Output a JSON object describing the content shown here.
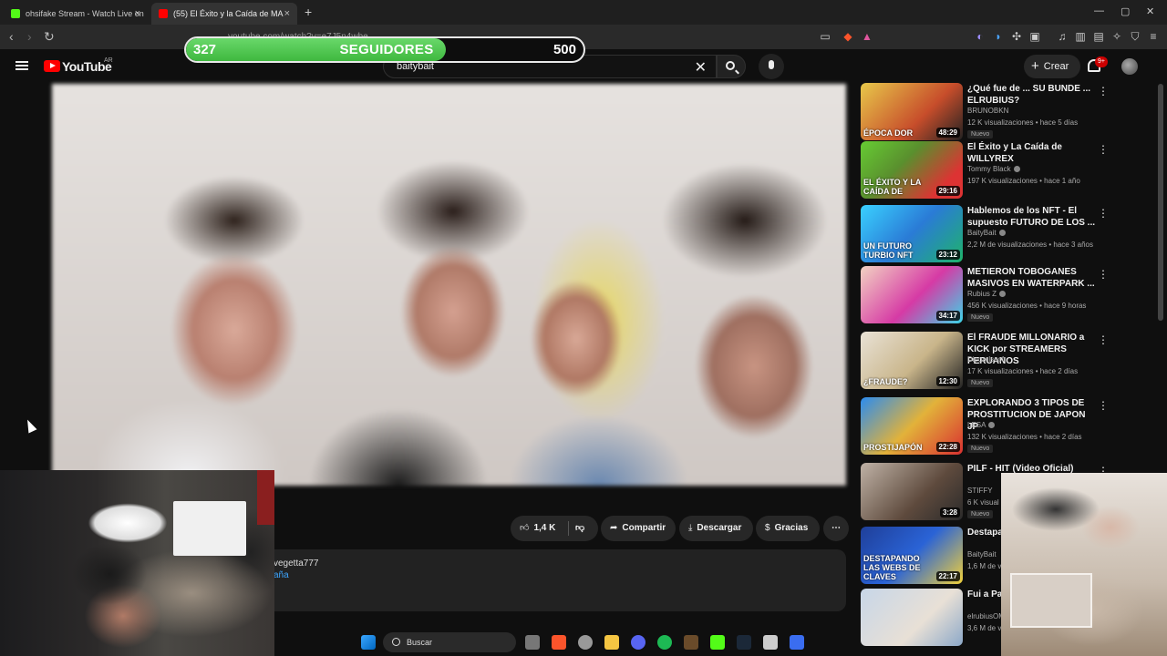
{
  "browser": {
    "tabs": [
      {
        "title": "ohsifake Stream - Watch Live on",
        "favicon_color": "#53fc18"
      },
      {
        "title": "(55) El Éxito y la Caída de MA",
        "favicon_color": "#ff0000"
      }
    ],
    "new_tab": "+",
    "address_partial": "youtube.com/watch?v=e7J5n4wbe"
  },
  "overlay": {
    "current": "327",
    "label": "SEGUIDORES",
    "goal": "500",
    "progress_fraction": 0.654,
    "bar_color": "#4cc24c"
  },
  "youtube": {
    "logo_text": "YouTube",
    "country": "AR",
    "search": {
      "value": "baitybait"
    },
    "create_label": "Crear",
    "notifications": "9+"
  },
  "actions": {
    "likes": "1,4 K",
    "share": "Compartir",
    "download": "Descargar",
    "thanks": "Gracias"
  },
  "description": {
    "line1": "vegetta777",
    "line2": "aña"
  },
  "related": [
    {
      "title": "¿Qué fue de ... SU BUNDE ... ELRUBIUS?",
      "channel": "BRUNOBKN",
      "meta": "12 K visualizaciones • hace 5 días",
      "duration": "48:29",
      "badge": "Nuevo",
      "verified": false,
      "thumb_text": "ÉPOCA DOR"
    },
    {
      "title": "El Éxito y La Caída de WILLYREX",
      "channel": "Tommy Black",
      "meta": "197 K visualizaciones • hace 1 año",
      "duration": "29:16",
      "badge": "",
      "verified": true,
      "thumb_text": "EL ÉXITO Y LA CAÍDA DE"
    },
    {
      "title": "Hablemos de los NFT - El supuesto FUTURO DE LOS ...",
      "channel": "BaityBait",
      "meta": "2,2 M de visualizaciones • hace 3 años",
      "duration": "23:12",
      "badge": "",
      "verified": true,
      "thumb_text": "UN FUTURO TURBIO NFT"
    },
    {
      "title": "METIERON TOBOGANES MASIVOS EN WATERPARK ...",
      "channel": "Rubius Z",
      "meta": "456 K visualizaciones • hace 9 horas",
      "duration": "34:17",
      "badge": "Nuevo",
      "verified": true,
      "thumb_text": ""
    },
    {
      "title": "El FRAUDE MILLONARIO a KICK por STREAMERS PERUANOS",
      "channel": "Diego Iscof",
      "meta": "17 K visualizaciones • hace 2 días",
      "duration": "12:30",
      "badge": "Nuevo",
      "verified": false,
      "thumb_text": "¿FRAUDE?"
    },
    {
      "title": "EXPLORANDO 3 TIPOS DE PROSTITUCION DE JAPON JP",
      "channel": "LESA",
      "meta": "132 K visualizaciones • hace 2 días",
      "duration": "22:28",
      "badge": "Nuevo",
      "verified": true,
      "thumb_text": "PROSTIJAPÓN"
    },
    {
      "title": "PILF - HIT (Video Oficial)",
      "channel": "STIFFY",
      "meta": "6 K visual",
      "duration": "3:28",
      "badge": "Nuevo",
      "verified": false,
      "thumb_text": ""
    },
    {
      "title": "Destapa... de las w...",
      "channel": "BaityBait",
      "meta": "1,6 M de v...",
      "duration": "22:17",
      "badge": "",
      "verified": false,
      "thumb_text": "DESTAPANDO LAS WEBS DE CLAVES"
    },
    {
      "title": "Fui a Pat...",
      "channel": "elrubiusOM",
      "meta": "3,6 M de v...",
      "duration": "",
      "badge": "",
      "verified": false,
      "thumb_text": ""
    }
  ],
  "taskbar": {
    "search_placeholder": "Buscar"
  }
}
